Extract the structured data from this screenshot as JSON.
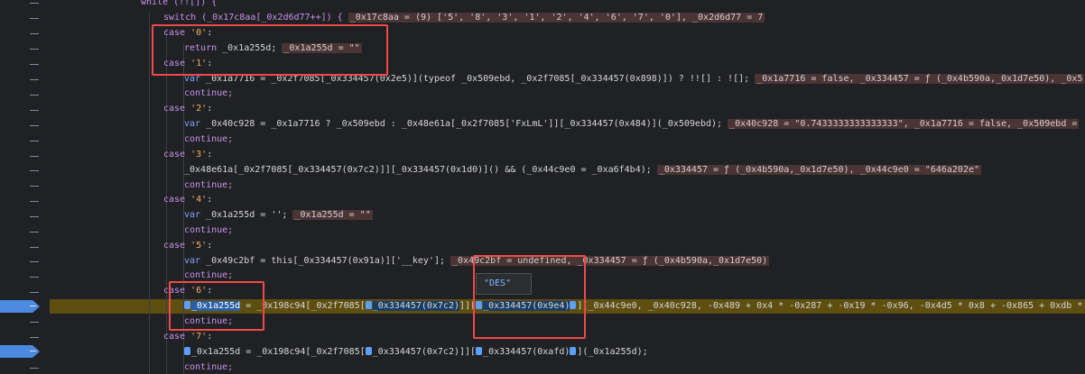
{
  "code_lines": [
    {
      "id": "while",
      "text": "while (!![]) {"
    },
    {
      "id": "switch",
      "main": "switch (_0x17c8aa[_0x2d6d77++]) {",
      "ann": "_0x17c8aa = (9) ['5', '8', '3', '1', '2', '4', '6', '7', '0'], _0x2d6d77 = 7"
    },
    {
      "id": "case0",
      "case_kw": "case",
      "case_val": "'0'",
      "colon": ":"
    },
    {
      "id": "return",
      "kw": "return",
      "rest": " _0x1a255d;",
      "ann": "_0x1a255d = \"\""
    },
    {
      "id": "case1",
      "case_kw": "case",
      "case_val": "'1'",
      "colon": ":"
    },
    {
      "id": "var1",
      "kw": "var",
      "rest": " _0x1a7716 = _0x2f7085[_0x334457(0x2e5)](typeof _0x509ebd, _0x2f7085[_0x334457(0x898)]) ? !![] : ![];",
      "ann": "_0x1a7716 = false, _0x334457 = ƒ (_0x4b590a,_0x1d7e50), _0x5"
    },
    {
      "id": "cont1",
      "text": "continue;"
    },
    {
      "id": "case2",
      "case_kw": "case",
      "case_val": "'2'",
      "colon": ":"
    },
    {
      "id": "var2",
      "kw": "var",
      "rest": " _0x40c928 = _0x1a7716 ? _0x509ebd : _0x48e61a[_0x2f7085['FxLmL']][_0x334457(0x484)](_0x509ebd);",
      "ann": "_0x40c928 = \"0.7433333333333333\", _0x1a7716 = false, _0x509ebd ="
    },
    {
      "id": "cont2",
      "text": "continue;"
    },
    {
      "id": "case3",
      "case_kw": "case",
      "case_val": "'3'",
      "colon": ":"
    },
    {
      "id": "stmt3",
      "rest": "_0x48e61a[_0x2f7085[_0x334457(0x7c2)]][_0x334457(0x1d0)]() && (_0x44c9e0 = _0xa6f4b4);",
      "ann": "_0x334457 = ƒ (_0x4b590a,_0x1d7e50), _0x44c9e0 = \"646a202e\""
    },
    {
      "id": "cont3",
      "text": "continue;"
    },
    {
      "id": "case4",
      "case_kw": "case",
      "case_val": "'4'",
      "colon": ":"
    },
    {
      "id": "var4",
      "kw": "var",
      "rest": " _0x1a255d = '';",
      "ann": "_0x1a255d = \"\""
    },
    {
      "id": "cont4",
      "text": "continue;"
    },
    {
      "id": "case5",
      "case_kw": "case",
      "case_val": "'5'",
      "colon": ":"
    },
    {
      "id": "var5",
      "kw": "var",
      "rest": " _0x49c2bf = this[_0x334457(0x91a)]['__key'];",
      "ann": "_0x49c2bf = undefined, _0x334457 = ƒ (_0x4b590a,_0x1d7e50)"
    },
    {
      "id": "cont5",
      "text": "continue;"
    },
    {
      "id": "case6",
      "case_kw": "case",
      "case_val": "'6'",
      "colon": ":"
    },
    {
      "id": "exec",
      "p1": "_0x1a255d",
      "p2": " = _0x198c94[_0x2f7085[",
      "p3": "_0x334457(0x7c2)",
      "p4": "]][",
      "p5": "_0x334457(0x9e4)",
      "p6": "](_0x44c9e0, _0x40c928, -0x489 + 0x4 * -0x287 + -0x19 * -0x96, -0x4d5 * 0x8 + -0x865 + 0xdb *"
    },
    {
      "id": "cont6",
      "text": "continue;"
    },
    {
      "id": "case7",
      "case_kw": "case",
      "case_val": "'7'",
      "colon": ":"
    },
    {
      "id": "line7",
      "p1": "_0x1a255d = _0x198c94[_0x2f7085[",
      "p2": "_0x334457(0x7c2)",
      "p3": "]][",
      "p4": "_0x334457(0xafd)",
      "p5": "](_0x1a255d);"
    },
    {
      "id": "cont7",
      "text": "continue;"
    }
  ],
  "tooltip": {
    "text": "\"DES\""
  },
  "colors": {
    "background": "#202124",
    "exec_highlight": "#5e4e10",
    "annotation_bg": "#4a3434",
    "red_box": "#f04a4a",
    "breakpoint": "#4c8ae0"
  }
}
